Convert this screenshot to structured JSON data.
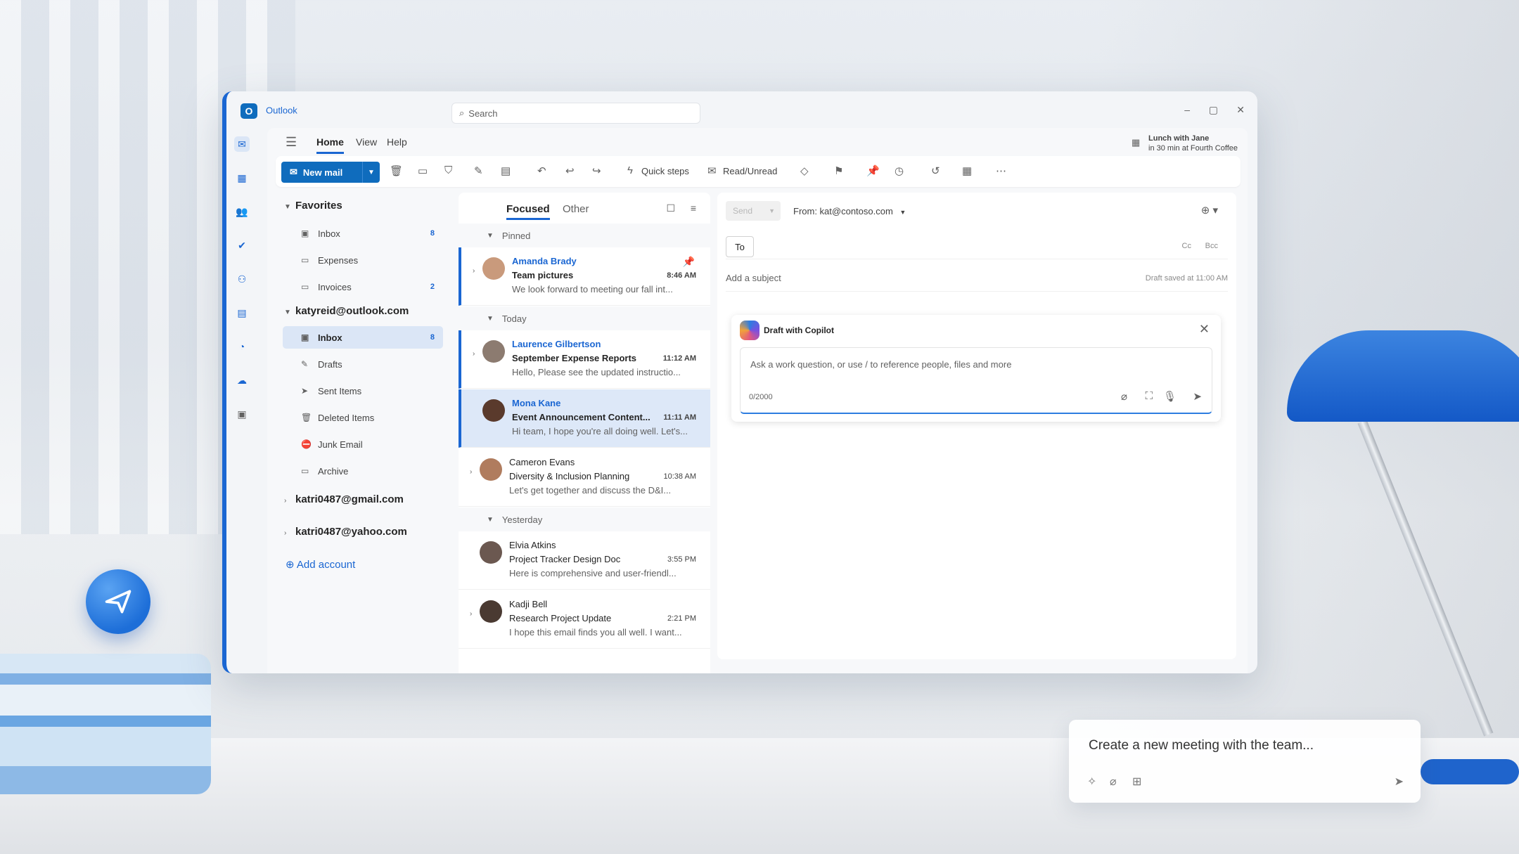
{
  "app": {
    "name": "Outlook",
    "logo_letter": "O"
  },
  "search": {
    "placeholder": "Search"
  },
  "window_controls": {
    "minimize": "–",
    "maximize": "▢",
    "close": "✕"
  },
  "menu": {
    "tabs": [
      "Home",
      "View",
      "Help"
    ],
    "active": "Home"
  },
  "reminder": {
    "title": "Lunch with Jane",
    "detail": "in 30 min at Fourth Coffee"
  },
  "ribbon": {
    "new_mail": "New mail",
    "quick_steps": "Quick steps",
    "read_unread": "Read/Unread"
  },
  "folders": {
    "favorites_label": "Favorites",
    "favorites": [
      {
        "label": "Inbox",
        "count": "8"
      },
      {
        "label": "Expenses",
        "count": ""
      },
      {
        "label": "Invoices",
        "count": "2"
      }
    ],
    "account1": "katyreid@outlook.com",
    "account1_items": [
      {
        "label": "Inbox",
        "count": "8"
      },
      {
        "label": "Drafts",
        "count": ""
      },
      {
        "label": "Sent Items",
        "count": ""
      },
      {
        "label": "Deleted Items",
        "count": ""
      },
      {
        "label": "Junk Email",
        "count": ""
      },
      {
        "label": "Archive",
        "count": ""
      }
    ],
    "account2": "katri0487@gmail.com",
    "account3": "katri0487@yahoo.com",
    "add_account": "Add account"
  },
  "maillist": {
    "tabs": [
      "Focused",
      "Other"
    ],
    "sections": [
      "Pinned",
      "Today",
      "Yesterday"
    ],
    "messages": [
      {
        "sender": "Amanda Brady",
        "subject": "Team pictures",
        "time": "8:46 AM",
        "preview": "We look forward to meeting our fall int..."
      },
      {
        "sender": "Laurence Gilbertson",
        "subject": "September Expense Reports",
        "time": "11:12 AM",
        "preview": "Hello, Please see the updated instructio..."
      },
      {
        "sender": "Mona Kane",
        "subject": "Event Announcement Content...",
        "time": "11:11 AM",
        "preview": "Hi team, I hope you're all doing well. Let's..."
      },
      {
        "sender": "Cameron Evans",
        "subject": "Diversity & Inclusion Planning",
        "time": "10:38 AM",
        "preview": "Let's get together and discuss the D&I..."
      },
      {
        "sender": "Elvia Atkins",
        "subject": "Project Tracker Design Doc",
        "time": "3:55 PM",
        "preview": "Here is comprehensive and user-friendl..."
      },
      {
        "sender": "Kadji Bell",
        "subject": "Research Project Update",
        "time": "2:21 PM",
        "preview": "I hope this email finds you all well. I want..."
      }
    ]
  },
  "compose": {
    "send": "Send",
    "from": "From: kat@contoso.com",
    "to": "To",
    "cc": "Cc",
    "bcc": "Bcc",
    "subject_placeholder": "Add a subject",
    "draft_saved": "Draft saved at 11:00 AM"
  },
  "copilot": {
    "title": "Draft with Copilot",
    "placeholder": "Ask a work question, or use / to reference people, files and more",
    "counter": "0/2000"
  },
  "floating_prompt": {
    "text": "Create a new meeting with the team..."
  },
  "colors": {
    "accent": "#1a66d2",
    "brand": "#0f6cbd",
    "selected_bg": "#dde8f8"
  }
}
